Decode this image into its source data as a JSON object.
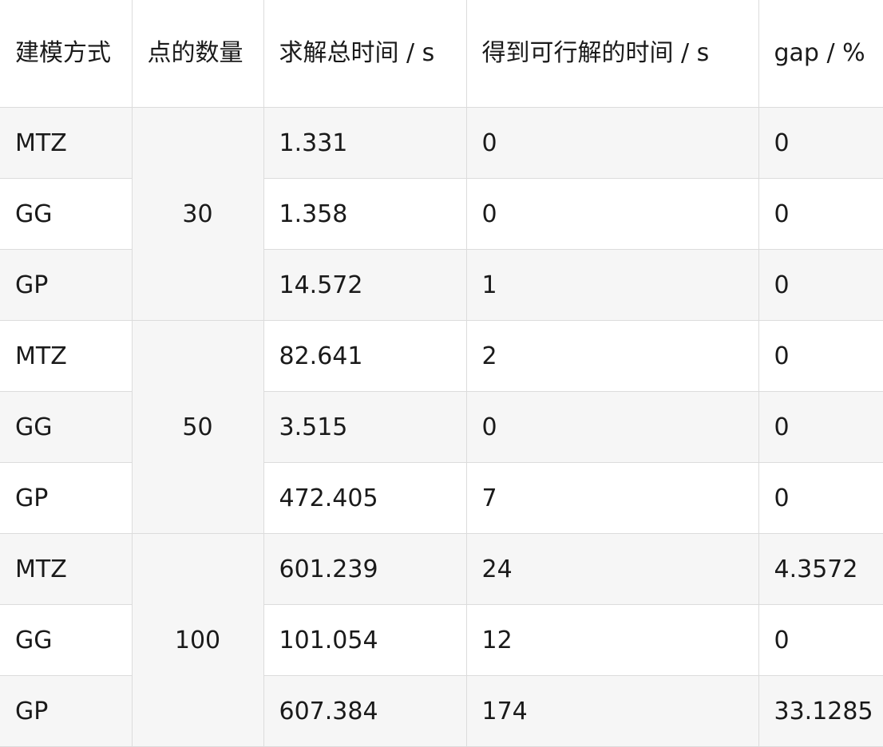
{
  "table": {
    "headers": [
      "建模方式",
      "点的数量",
      "求解总时间 / s",
      "得到可行解的时间 / s",
      "gap / %"
    ],
    "groups": [
      {
        "count": "30",
        "rows": [
          {
            "method": "MTZ",
            "total_time": "1.331",
            "feasible_time": "0",
            "gap": "0"
          },
          {
            "method": "GG",
            "total_time": "1.358",
            "feasible_time": "0",
            "gap": "0"
          },
          {
            "method": "GP",
            "total_time": "14.572",
            "feasible_time": "1",
            "gap": "0"
          }
        ]
      },
      {
        "count": "50",
        "rows": [
          {
            "method": "MTZ",
            "total_time": "82.641",
            "feasible_time": "2",
            "gap": "0"
          },
          {
            "method": "GG",
            "total_time": "3.515",
            "feasible_time": "0",
            "gap": "0"
          },
          {
            "method": "GP",
            "total_time": "472.405",
            "feasible_time": "7",
            "gap": "0"
          }
        ]
      },
      {
        "count": "100",
        "rows": [
          {
            "method": "MTZ",
            "total_time": "601.239",
            "feasible_time": "24",
            "gap": "4.3572"
          },
          {
            "method": "GG",
            "total_time": "101.054",
            "feasible_time": "12",
            "gap": "0"
          },
          {
            "method": "GP",
            "total_time": "607.384",
            "feasible_time": "174",
            "gap": "33.1285"
          }
        ]
      }
    ]
  }
}
